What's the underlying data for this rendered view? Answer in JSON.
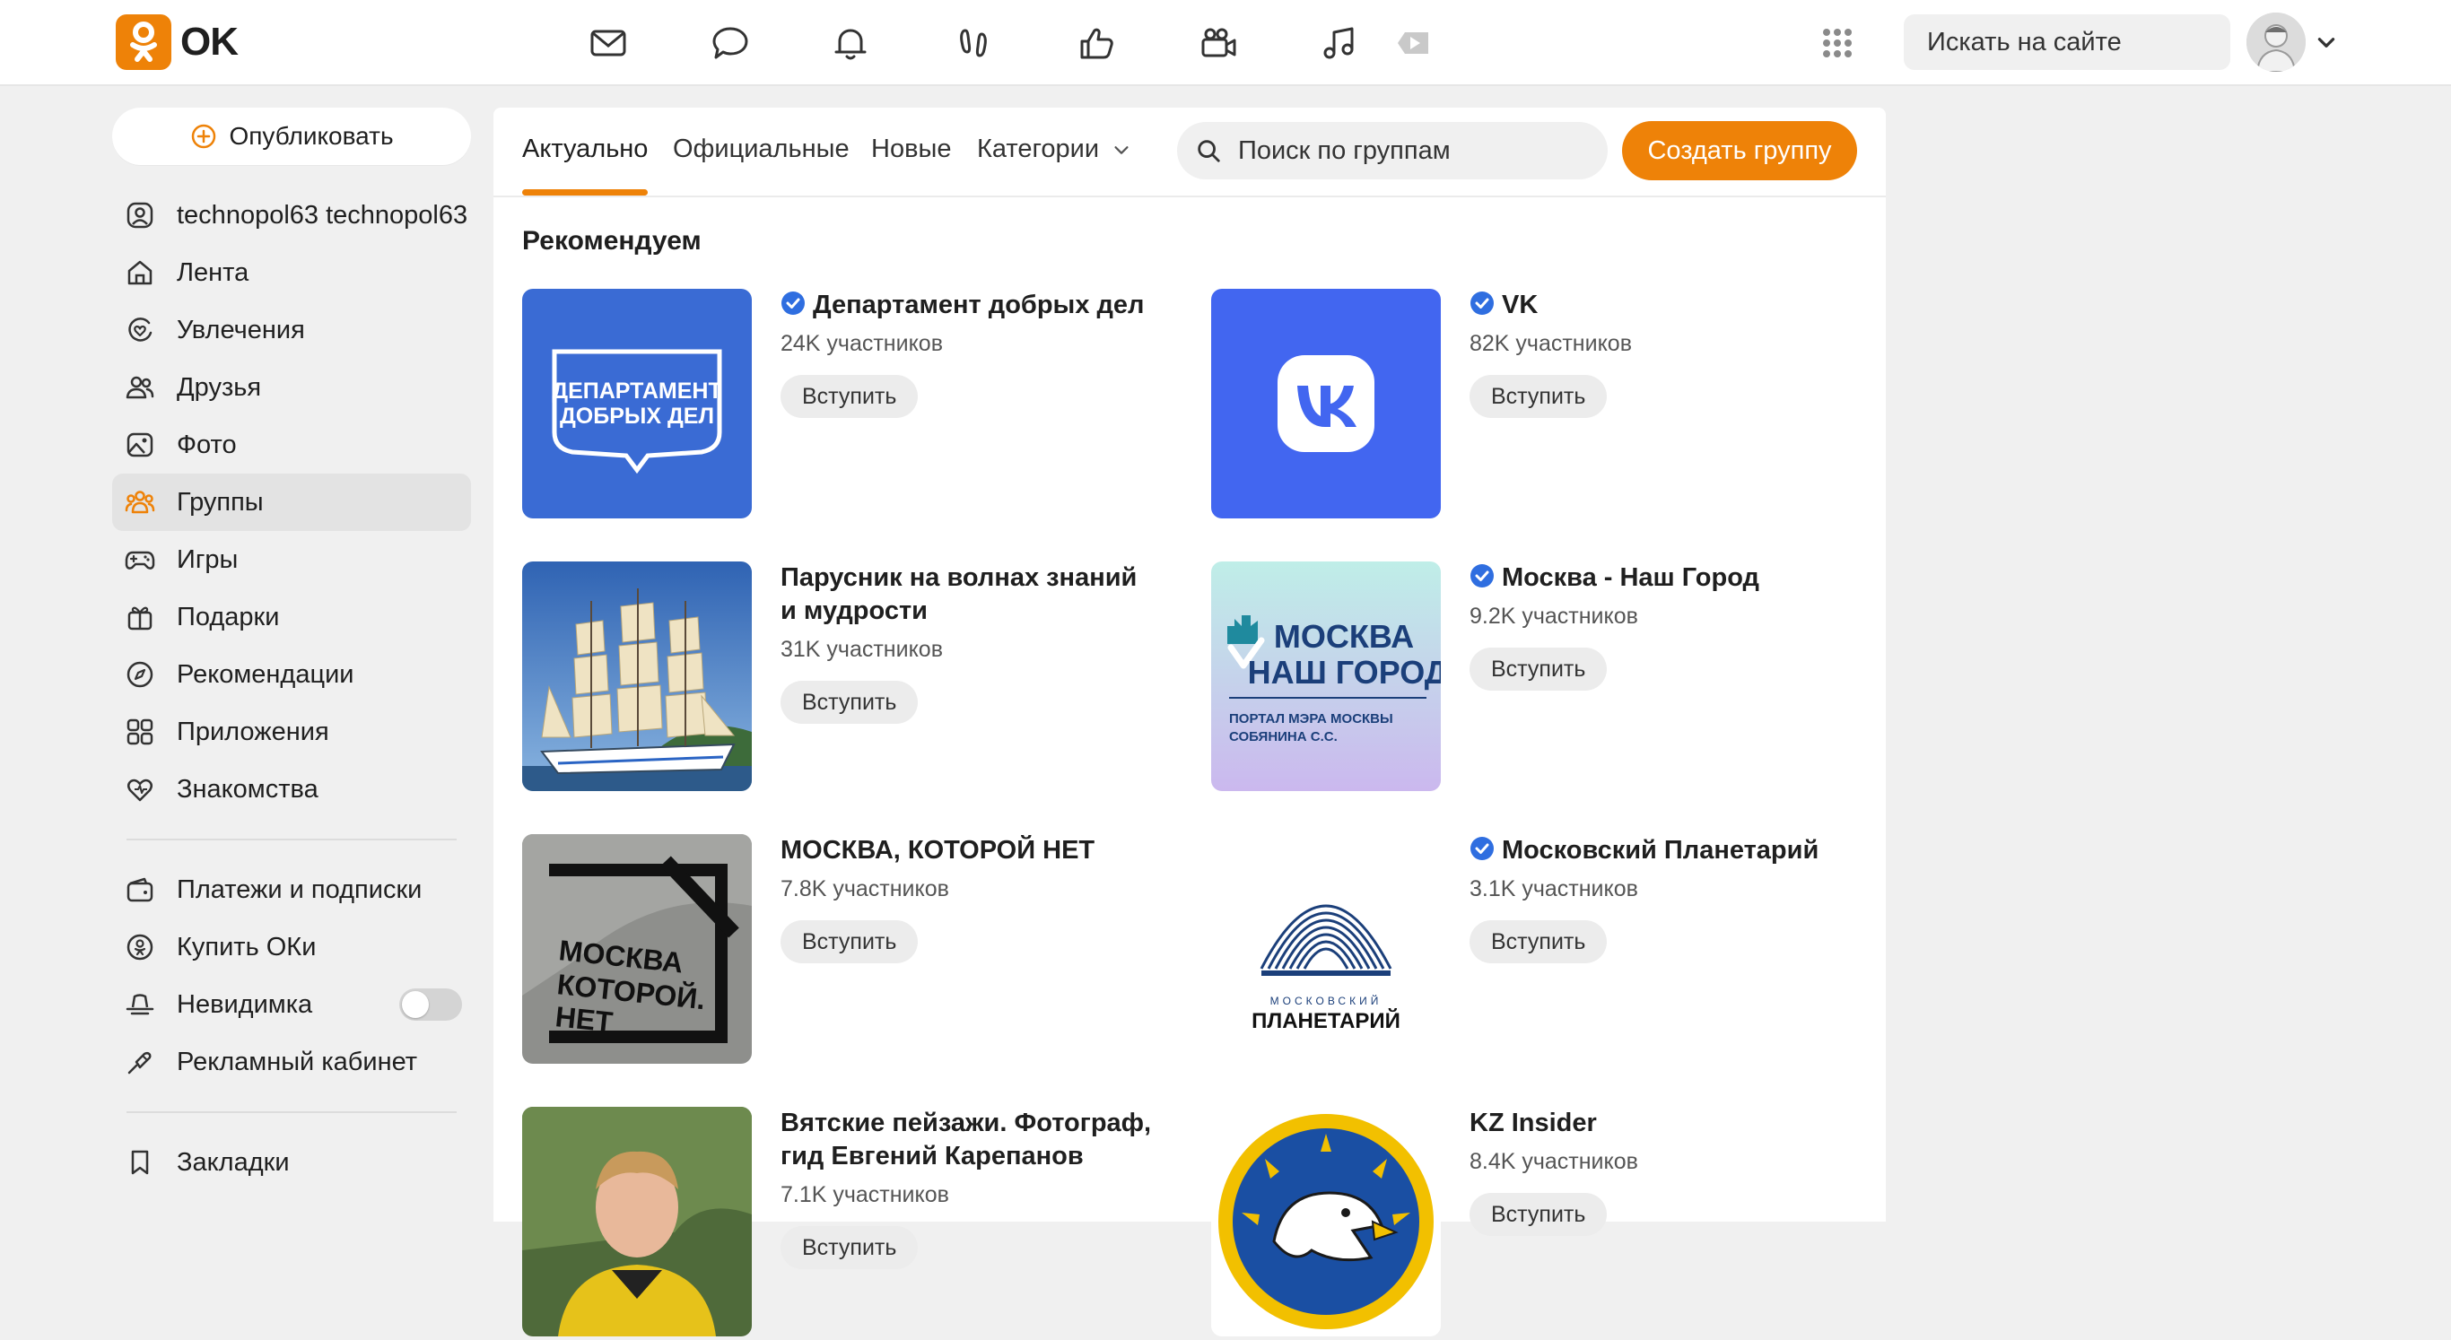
{
  "header": {
    "logo_text": "OK",
    "site_search_placeholder": "Искать на сайте",
    "icons": [
      "mail-icon",
      "chat-icon",
      "bell-icon",
      "guests-icon",
      "likes-icon",
      "video-icon",
      "music-icon",
      "apps-grid-icon",
      "search-icon",
      "chevron-down-icon"
    ],
    "accent": "#ee8208"
  },
  "sidebar": {
    "publish_label": "Опубликовать",
    "items": [
      {
        "label": "technopol63 technopol63",
        "icon": "profile-icon"
      },
      {
        "label": "Лента",
        "icon": "home-icon"
      },
      {
        "label": "Увлечения",
        "icon": "hobbies-icon"
      },
      {
        "label": "Друзья",
        "icon": "friends-icon"
      },
      {
        "label": "Фото",
        "icon": "photo-icon"
      },
      {
        "label": "Группы",
        "icon": "groups-icon",
        "active": true
      },
      {
        "label": "Игры",
        "icon": "gamepad-icon"
      },
      {
        "label": "Подарки",
        "icon": "gift-icon"
      },
      {
        "label": "Рекомендации",
        "icon": "compass-icon"
      },
      {
        "label": "Приложения",
        "icon": "apps-icon"
      },
      {
        "label": "Знакомства",
        "icon": "dating-icon"
      }
    ],
    "items2": [
      {
        "label": "Платежи и подписки",
        "icon": "wallet-icon"
      },
      {
        "label": "Купить ОКи",
        "icon": "coins-icon"
      },
      {
        "label": "Невидимка",
        "icon": "incognito-icon",
        "toggle": false
      },
      {
        "label": "Рекламный кабинет",
        "icon": "ads-icon"
      }
    ],
    "items3": [
      {
        "label": "Закладки",
        "icon": "bookmark-icon"
      }
    ]
  },
  "main": {
    "tabs": [
      {
        "label": "Актуально",
        "active": true
      },
      {
        "label": "Официальные"
      },
      {
        "label": "Новые"
      },
      {
        "label": "Категории"
      }
    ],
    "group_search_placeholder": "Поиск по группам",
    "create_button": "Создать группу",
    "section_title": "Рекомендуем",
    "join_label": "Вступить",
    "groups": [
      {
        "title": "Департамент добрых дел",
        "members": "24K участников",
        "verified": true,
        "thumb_text": "ДЕПАРТАМЕНТ ДОБРЫХ ДЕЛ"
      },
      {
        "title": "VK",
        "members": "82K участников",
        "verified": true,
        "thumb_text": "VK"
      },
      {
        "title": "Парусник на волнах знаний и мудрости",
        "members": "31K участников",
        "verified": false
      },
      {
        "title": "Москва - Наш Город",
        "members": "9.2K участников",
        "verified": true,
        "thumb_text": "МОСКВА НАШ ГОРОД",
        "thumb_sub": "ПОРТАЛ МЭРА МОСКВЫ СОБЯНИНА С.С."
      },
      {
        "title": "МОСКВА, КОТОРОЙ НЕТ",
        "members": "7.8K участников",
        "verified": false,
        "thumb_text": "МОСКВА КОТОРОЙ НЕТ"
      },
      {
        "title": "Московский Планетарий",
        "members": "3.1K участников",
        "verified": true,
        "thumb_text": "ПЛАНЕТАРИЙ",
        "thumb_sub": "МОСКОВСКИЙ"
      },
      {
        "title": "Вятские пейзажи. Фотограф, гид Евгений Карепанов",
        "members": "7.1K участников",
        "verified": false
      },
      {
        "title": "KZ Insider",
        "members": "8.4K участников",
        "verified": false
      }
    ]
  }
}
